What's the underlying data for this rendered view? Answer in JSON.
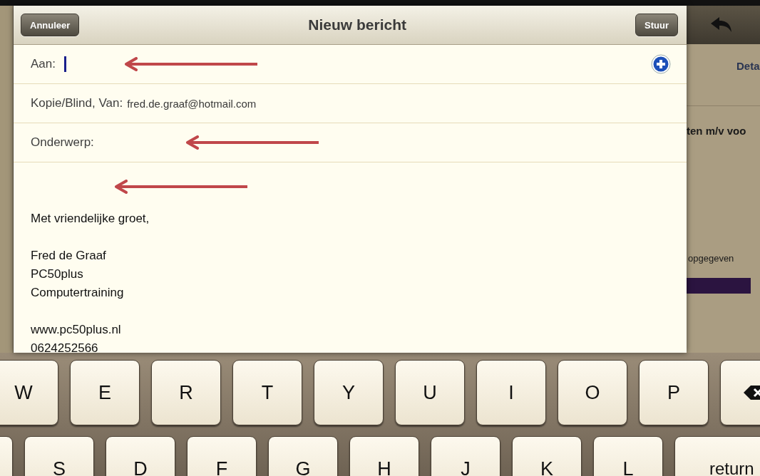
{
  "compose": {
    "title": "Nieuw bericht",
    "cancel_button": "Annuleer",
    "send_button": "Stuur",
    "fields": [
      {
        "kind": "to",
        "label": "Aan:",
        "cursor": true,
        "arrow": true
      },
      {
        "kind": "from",
        "label": "Kopie/Blind, Van:",
        "value": "fred.de.graaf@hotmail.com",
        "cursor": false,
        "arrow": false
      },
      {
        "kind": "subject",
        "label": "Onderwerp:",
        "cursor": false,
        "arrow": true
      }
    ],
    "body": {
      "arrow": true,
      "groups": [
        [
          "Met vriendelijke groet,"
        ],
        [
          "Fred de Graaf",
          "PC50plus",
          "Computertraining"
        ],
        [
          "www.pc50plus.nl",
          "0624252566"
        ]
      ]
    }
  },
  "background": {
    "detail_label": "Deta",
    "heading": "ten m/v voo",
    "note": "opgegeven"
  },
  "keyboard": {
    "rows": [
      [
        {
          "kind": "letter",
          "label": "W"
        },
        {
          "kind": "letter",
          "label": "E"
        },
        {
          "kind": "letter",
          "label": "R"
        },
        {
          "kind": "letter",
          "label": "T"
        },
        {
          "kind": "letter",
          "label": "Y"
        },
        {
          "kind": "letter",
          "label": "U"
        },
        {
          "kind": "letter",
          "label": "I"
        },
        {
          "kind": "letter",
          "label": "O"
        },
        {
          "kind": "letter",
          "label": "P"
        },
        {
          "kind": "delete"
        }
      ],
      [
        {
          "kind": "blank"
        },
        {
          "kind": "letter",
          "label": "S"
        },
        {
          "kind": "letter",
          "label": "D"
        },
        {
          "kind": "letter",
          "label": "F"
        },
        {
          "kind": "letter",
          "label": "G"
        },
        {
          "kind": "letter",
          "label": "H"
        },
        {
          "kind": "letter",
          "label": "J"
        },
        {
          "kind": "letter",
          "label": "K"
        },
        {
          "kind": "letter",
          "label": "L"
        },
        {
          "kind": "return",
          "label": "return"
        }
      ]
    ]
  }
}
